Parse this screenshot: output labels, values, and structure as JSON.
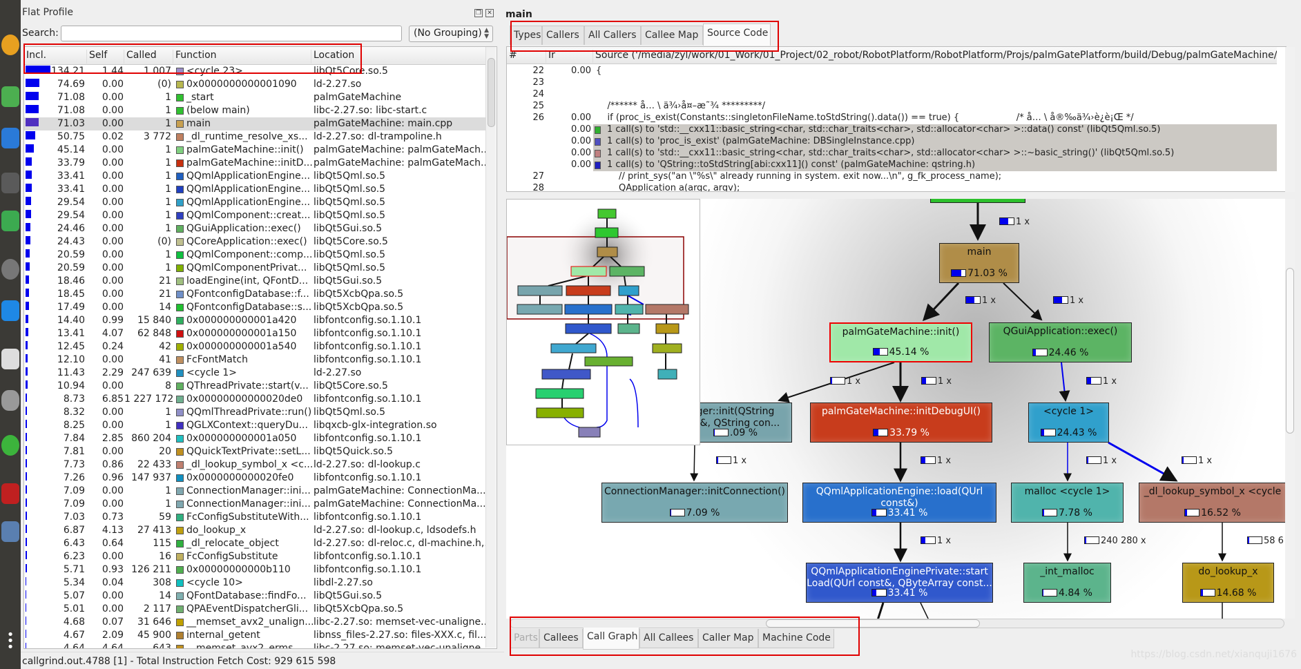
{
  "flat_profile": {
    "title": "Flat Profile",
    "search_label": "Search:",
    "search_value": "",
    "grouping": "(No Grouping)",
    "columns": [
      "Incl.",
      "Self",
      "Called",
      "Function",
      "Location"
    ],
    "selected_row": 4,
    "rows": [
      [
        "134.21",
        "1.44",
        "1 007",
        "<cycle 23>",
        "libQt5Core.so.5",
        "#9a8ec8"
      ],
      [
        "74.69",
        "0.00",
        "(0)",
        "0x0000000000001090",
        "ld-2.27.so",
        "#b8b850"
      ],
      [
        "71.08",
        "0.00",
        "1",
        "_start",
        "palmGateMachine",
        "#30c030"
      ],
      [
        "71.08",
        "0.00",
        "1",
        "(below main)",
        "libc-2.27.so: libc-start.c",
        "#30c030"
      ],
      [
        "71.03",
        "0.00",
        "1",
        "main",
        "palmGateMachine: main.cpp",
        "#c8a050"
      ],
      [
        "50.75",
        "0.02",
        "3 772",
        "_dl_runtime_resolve_xs...",
        "ld-2.27.so: dl-trampoline.h",
        "#c08060"
      ],
      [
        "45.14",
        "0.00",
        "1",
        "palmGateMachine::init()",
        "palmGateMachine: palmGateMach...",
        "#80d080"
      ],
      [
        "33.79",
        "0.00",
        "1",
        "palmGateMachine::initD...",
        "palmGateMachine: palmGateMach...",
        "#c83010"
      ],
      [
        "33.41",
        "0.00",
        "1",
        "QQmlApplicationEngine...",
        "libQt5Qml.so.5",
        "#2060c0"
      ],
      [
        "33.41",
        "0.00",
        "1",
        "QQmlApplicationEngine...",
        "libQt5Qml.so.5",
        "#2040c0"
      ],
      [
        "29.54",
        "0.00",
        "1",
        "QQmlApplicationEngine...",
        "libQt5Qml.so.5",
        "#30a0c8"
      ],
      [
        "29.54",
        "0.00",
        "1",
        "QQmlComponent::creat...",
        "libQt5Qml.so.5",
        "#3040c0"
      ],
      [
        "24.46",
        "0.00",
        "1",
        "QGuiApplication::exec()",
        "libQt5Gui.so.5",
        "#60b060"
      ],
      [
        "24.43",
        "0.00",
        "(0)",
        "QCoreApplication::exec()",
        "libQt5Core.so.5",
        "#c0c090"
      ],
      [
        "20.59",
        "0.00",
        "1",
        "QQmlComponent::comp...",
        "libQt5Qml.so.5",
        "#10c040"
      ],
      [
        "20.59",
        "0.00",
        "1",
        "QQmlComponentPrivat...",
        "libQt5Qml.so.5",
        "#80b000"
      ],
      [
        "18.46",
        "0.00",
        "21",
        "loadEngine(int, QFontD...",
        "libQt5Gui.so.5",
        "#a0c080"
      ],
      [
        "18.45",
        "0.00",
        "21",
        "QFontconfigDatabase::f...",
        "libQt5XcbQpa.so.5",
        "#7090c8"
      ],
      [
        "17.49",
        "0.00",
        "14",
        "QFontconfigDatabase::s...",
        "libQt5XcbQpa.so.5",
        "#20c030"
      ],
      [
        "14.40",
        "0.99",
        "15 840",
        "0x000000000001a420",
        "libfontconfig.so.1.10.1",
        "#30b060"
      ],
      [
        "13.41",
        "4.07",
        "62 848",
        "0x000000000001a150",
        "libfontconfig.so.1.10.1",
        "#d01010"
      ],
      [
        "12.45",
        "0.24",
        "42",
        "0x000000000001a540",
        "libfontconfig.so.1.10.1",
        "#a0b000"
      ],
      [
        "12.10",
        "0.00",
        "41",
        "FcFontMatch",
        "libfontconfig.so.1.10.1",
        "#c09060"
      ],
      [
        "11.43",
        "2.29",
        "247 639",
        "<cycle 1>",
        "ld-2.27.so",
        "#2090c0"
      ],
      [
        "10.94",
        "0.00",
        "8",
        "QThreadPrivate::start(v...",
        "libQt5Core.so.5",
        "#60b060"
      ],
      [
        "8.73",
        "6.85",
        "1 227 172",
        "0x00000000000020de0",
        "libfontconfig.so.1.10.1",
        "#70b090"
      ],
      [
        "8.32",
        "0.00",
        "1",
        "QQmlThreadPrivate::run()",
        "libQt5Qml.so.5",
        "#9090c8"
      ],
      [
        "8.25",
        "0.00",
        "1",
        "QGLXContext::queryDu...",
        "libqxcb-glx-integration.so",
        "#4030c0"
      ],
      [
        "7.84",
        "2.85",
        "860 204",
        "0x000000000001a050",
        "libfontconfig.so.1.10.1",
        "#20c0c0"
      ],
      [
        "7.81",
        "0.00",
        "20",
        "QQuickTextPrivate::setL...",
        "libQt5Quick.so.5",
        "#c09020"
      ],
      [
        "7.73",
        "0.86",
        "22 433",
        "_dl_lookup_symbol_x <c...",
        "ld-2.27.so: dl-lookup.c",
        "#c08070"
      ],
      [
        "7.26",
        "0.96",
        "147 937",
        "0x0000000000020fe0",
        "libfontconfig.so.1.10.1",
        "#1090c0"
      ],
      [
        "7.09",
        "0.00",
        "1",
        "ConnectionManager::ini...",
        "palmGateMachine: ConnectionMa...",
        "#80a8b0"
      ],
      [
        "7.09",
        "0.00",
        "1",
        "ConnectionManager::ini...",
        "palmGateMachine: ConnectionMa...",
        "#80a8b0"
      ],
      [
        "7.03",
        "0.73",
        "59",
        "FcConfigSubstituteWith...",
        "libfontconfig.so.1.10.1",
        "#30b080"
      ],
      [
        "6.87",
        "4.13",
        "27 413",
        "do_lookup_x",
        "ld-2.27.so: dl-lookup.c, ldsodefs.h",
        "#c0a010"
      ],
      [
        "6.43",
        "0.64",
        "115",
        "_dl_relocate_object",
        "ld-2.27.so: dl-reloc.c, dl-machine.h,...",
        "#30b040"
      ],
      [
        "6.23",
        "0.00",
        "16",
        "FcConfigSubstitute",
        "libfontconfig.so.1.10.1",
        "#c0b060"
      ],
      [
        "5.71",
        "0.93",
        "126 211",
        "0x00000000000b110",
        "libfontconfig.so.1.10.1",
        "#50b050"
      ],
      [
        "5.34",
        "0.04",
        "308",
        "<cycle 10>",
        "libdl-2.27.so",
        "#10c0c0"
      ],
      [
        "5.07",
        "0.00",
        "14",
        "QFontDatabase::findFo...",
        "libQt5Gui.so.5",
        "#80b0b0"
      ],
      [
        "5.01",
        "0.00",
        "2 117",
        "QPAEventDispatcherGli...",
        "libQt5XcbQpa.so.5",
        "#70b070"
      ],
      [
        "4.68",
        "0.07",
        "31 646",
        "__memset_avx2_unalign...",
        "libc-2.27.so: memset-vec-unaligne...",
        "#c0a000"
      ],
      [
        "4.67",
        "2.09",
        "45 900",
        "internal_getent",
        "libnss_files-2.27.so: files-XXX.c, fil...",
        "#b08030"
      ],
      [
        "4.64",
        "4.64",
        "643",
        "__memset_avx2_erms",
        "libc-2.27.so: memset-vec-unaligne...",
        "#c09020"
      ]
    ]
  },
  "status_bar": "callgrind.out.4788 [1] - Total Instruction Fetch Cost: 929 615 598",
  "detail": {
    "function": "main",
    "top_tabs": [
      "Types",
      "Callers",
      "All Callers",
      "Callee Map",
      "Source Code"
    ],
    "top_active": "Source Code",
    "bottom_tabs": [
      "Parts",
      "Callees",
      "Call Graph",
      "All Callees",
      "Caller Map",
      "Machine Code"
    ],
    "bottom_active": "Call Graph",
    "source": {
      "columns": [
        "#",
        "Ir",
        "Source ('/media/zyl/work/01_Work/01_Project/02_robot/RobotPlatform/RobotPlatform/Projs/palmGatePlatform/build/Debug/palmGateMachine/pal"
      ],
      "lines": [
        {
          "n": "22",
          "ir": "0.00",
          "text": "{"
        },
        {
          "n": "23",
          "ir": "",
          "text": ""
        },
        {
          "n": "24",
          "ir": "",
          "text": ""
        },
        {
          "n": "25",
          "ir": "",
          "text": "    /****** å… \\ ä¾›å¤–æ˜¾ *********/"
        },
        {
          "n": "26",
          "ir": "0.00",
          "text": "    if (proc_is_exist(Constants::singletonFileName.toStdString().data()) == true) {                    /* å… \\ å®‰ä¾›è¿è¡Œ */"
        },
        {
          "n": "",
          "ir": "0.00",
          "call": true,
          "color": "#30b030",
          "text": "1 call(s) to 'std::__cxx11::basic_string<char, std::char_traits<char>, std::allocator<char> >::data() const' (libQt5Qml.so.5)"
        },
        {
          "n": "",
          "ir": "0.00",
          "call": true,
          "color": "#5050c0",
          "text": "1 call(s) to 'proc_is_exist' (palmGateMachine: DBSingleInstance.cpp)"
        },
        {
          "n": "",
          "ir": "0.00",
          "call": true,
          "color": "#c08080",
          "text": "1 call(s) to 'std::__cxx11::basic_string<char, std::char_traits<char>, std::allocator<char> >::~basic_string()' (libQt5Qml.so.5)"
        },
        {
          "n": "",
          "ir": "0.00",
          "call": true,
          "color": "#2020c0",
          "text": "1 call(s) to 'QString::toStdString[abi:cxx11]() const' (palmGateMachine: qstring.h)"
        },
        {
          "n": "27",
          "ir": "",
          "text": "        // print_sys(\"an \\\"%s\\\" already running in system. exit now...\\n\", g_fk_process_name);"
        },
        {
          "n": "28",
          "ir": "",
          "text": "        QApplication a(argc, argv);"
        }
      ]
    },
    "call_graph": {
      "nodes": [
        {
          "name": "main",
          "pct": "71.03 %",
          "fill": 71.03,
          "color": "#b08d48"
        },
        {
          "name": "palmGateMachine::init()",
          "pct": "45.14 %",
          "fill": 45.14,
          "color": "#a0e8a8",
          "current": true
        },
        {
          "name": "QGuiApplication::exec()",
          "pct": "24.46 %",
          "fill": 24.46,
          "color": "#5cb464"
        },
        {
          "name": "ger::init(QString\nst&, QString con...",
          "pct": ".09 %",
          "fill": 7.09,
          "color": "#78a4ac"
        },
        {
          "name": "palmGateMachine::initDebugUI()",
          "pct": "33.79 %",
          "fill": 33.79,
          "color": "#c83c1c"
        },
        {
          "name": "<cycle 1>",
          "pct": "24.43 %",
          "fill": 24.43,
          "color": "#30a0cc"
        },
        {
          "name": "ConnectionManager::initConnection()",
          "pct": "7.09 %",
          "fill": 7.09,
          "color": "#78a8b0"
        },
        {
          "name": "QQmlApplicationEngine::load(QUrl\nconst&)",
          "pct": "33.41 %",
          "fill": 33.41,
          "color": "#2870cc"
        },
        {
          "name": "malloc <cycle 1>",
          "pct": "7.78 %",
          "fill": 7.78,
          "color": "#50b4ac"
        },
        {
          "name": "_dl_lookup_symbol_x <cycle",
          "pct": "16.52 %",
          "fill": 16.52,
          "color": "#b47868"
        },
        {
          "name": "QQmlApplicationEnginePrivate::start\nLoad(QUrl const&, QByteArray const...",
          "pct": "33.41 %",
          "fill": 33.41,
          "color": "#3058cc"
        },
        {
          "name": "_int_malloc",
          "pct": "4.84 %",
          "fill": 4.84,
          "color": "#5cb48c"
        },
        {
          "name": "do_lookup_x",
          "pct": "14.68 %",
          "fill": 14.68,
          "color": "#b89818"
        }
      ],
      "edges": [
        "1 x",
        "1 x",
        "1 x",
        "1 x",
        "1 x",
        "1 x",
        "1 x",
        "1 x",
        "1 x",
        "1 x",
        "1 x",
        "240 280 x",
        "58 6"
      ]
    }
  },
  "watermark": "https://blog.csdn.net/xianquji1676"
}
